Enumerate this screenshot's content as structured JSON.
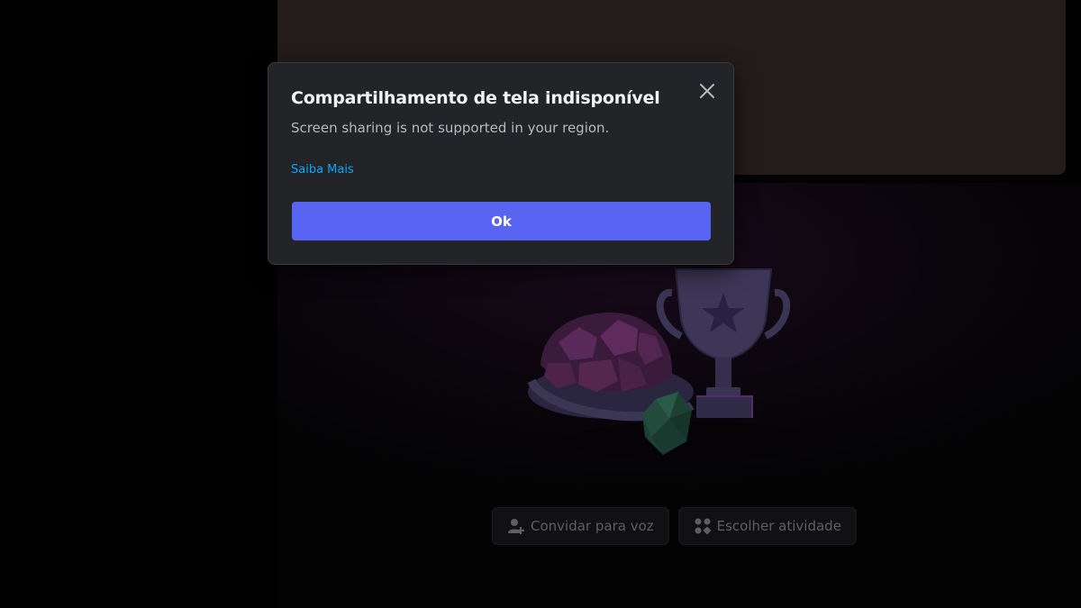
{
  "dialog": {
    "title": "Compartilhamento de tela indisponível",
    "message": "Screen sharing is not supported in your region.",
    "learn_more": "Saiba Mais",
    "ok_label": "Ok",
    "accent": "#5865f2",
    "link_color": "#00a8fc"
  },
  "voice_actions": {
    "invite_label": "Convidar para voz",
    "invite_icon": "add-user-icon",
    "activity_label": "Escolher atividade",
    "activity_icon": "activities-icon"
  },
  "illustration": {
    "items": [
      "turtle-shell",
      "trophy-star",
      "d20-die"
    ]
  }
}
